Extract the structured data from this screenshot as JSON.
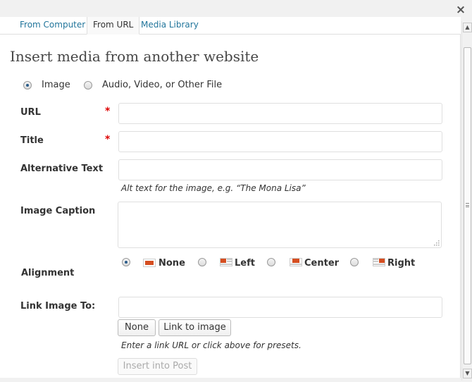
{
  "tabs": [
    {
      "label": "From Computer"
    },
    {
      "label": "From URL"
    },
    {
      "label": "Media Library"
    }
  ],
  "heading": "Insert media from another website",
  "media_type": {
    "options": [
      "Image",
      "Audio, Video, or Other File"
    ],
    "selected": "Image"
  },
  "fields": {
    "url": {
      "label": "URL",
      "value": ""
    },
    "title": {
      "label": "Title",
      "value": ""
    },
    "alt_text": {
      "label": "Alternative Text",
      "value": "",
      "hint": "Alt text for the image, e.g. “The Mona Lisa”"
    },
    "caption": {
      "label": "Image Caption",
      "value": ""
    },
    "link": {
      "label": "Link Image To:",
      "value": "",
      "hint": "Enter a link URL or click above for presets."
    }
  },
  "required_mark": "*",
  "alignment": {
    "label": "Alignment",
    "options": [
      "None",
      "Left",
      "Center",
      "Right"
    ],
    "selected": "None"
  },
  "link_buttons": {
    "none": "None",
    "link_to_image": "Link to image"
  },
  "insert_button": "Insert into Post",
  "close_symbol": "×",
  "colors": {
    "accent": "#21759b",
    "required": "#dd0000",
    "align_icon": "#d54e21"
  }
}
